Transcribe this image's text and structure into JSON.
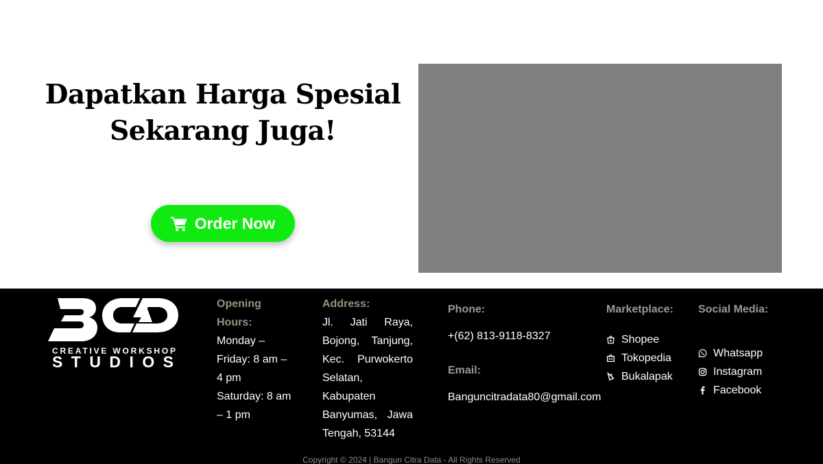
{
  "hero": {
    "title_line1": "Dapatkan Harga Spesial",
    "title_line2": "Sekarang Juga!",
    "order_button": {
      "label": "Order Now",
      "icon": "cart-icon"
    },
    "media_color": "#808080",
    "button_color": "#11ea11"
  },
  "footer": {
    "logo": {
      "monogram": "BCD",
      "line1": "CREATIVE WORKSHOP",
      "line2": "STUDIOS"
    },
    "hours": {
      "heading_line1": "Opening",
      "heading_line2": "Hours:",
      "lines": [
        "Monday –",
        "Friday: 8 am –",
        "4 pm",
        "Saturday: 8 am",
        "– 1 pm"
      ]
    },
    "address": {
      "heading": "Address:",
      "text": "Jl. Jati Raya, Bojong, Tanjung, Kec. Purwokerto Selatan, Kabupaten Banyumas, Jawa Tengah, 53144"
    },
    "contact": {
      "phone_heading": "Phone:",
      "phone": "+(62) 813-9118-8327",
      "email_heading": "Email:",
      "email": "Banguncitradata80@gmail.com"
    },
    "marketplace": {
      "heading": "Marketplace:",
      "items": [
        {
          "label": "Shopee",
          "icon": "shopee-icon"
        },
        {
          "label": "Tokopedia",
          "icon": "tokopedia-icon"
        },
        {
          "label": "Bukalapak",
          "icon": "bukalapak-icon"
        }
      ]
    },
    "social": {
      "heading": "Social Media:",
      "items": [
        {
          "label": "Whatsapp",
          "icon": "whatsapp-icon"
        },
        {
          "label": "Instagram",
          "icon": "instagram-icon"
        },
        {
          "label": "Facebook",
          "icon": "facebook-icon"
        }
      ]
    },
    "copyright": "Copyright © 2024 | Bangun Citra Data - All Rights Reserved"
  }
}
